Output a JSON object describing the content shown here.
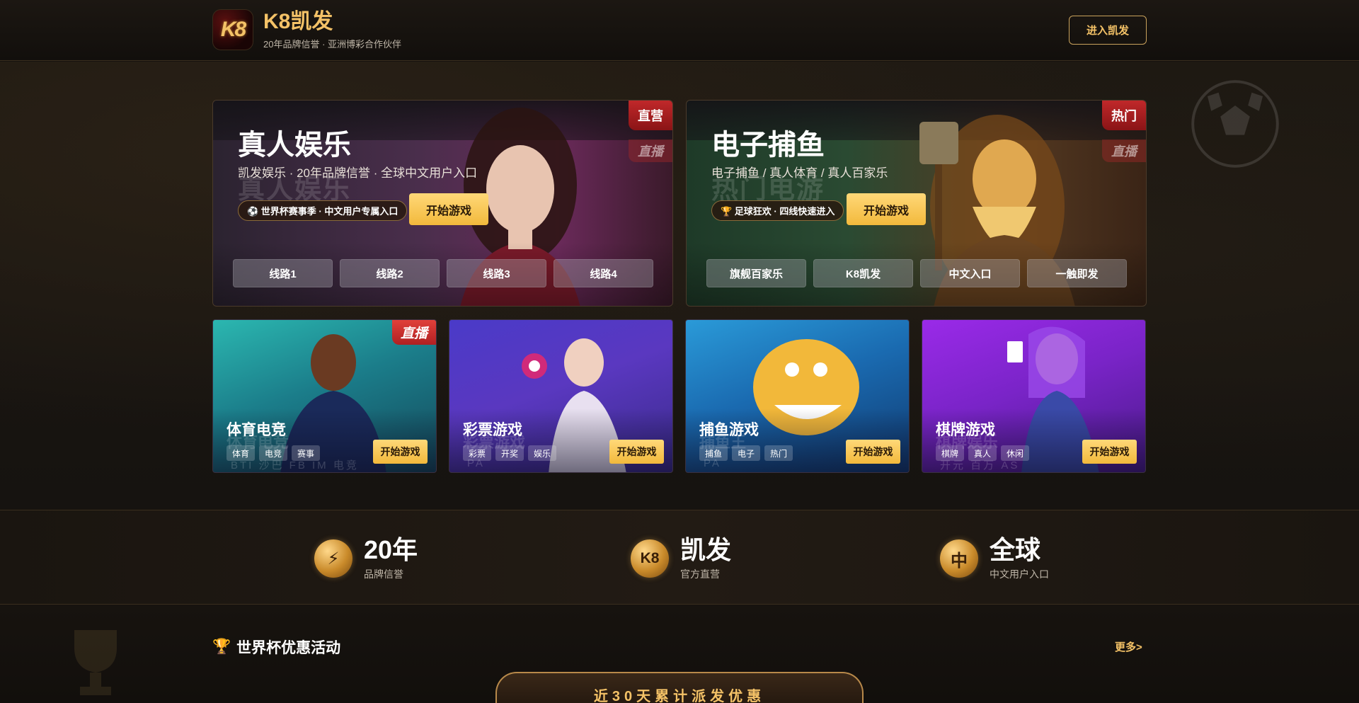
{
  "header": {
    "logo_text": "K8",
    "brand_name": "K8凯发",
    "tagline": "20年品牌信誉 · 亚洲博彩合作伙伴",
    "enter_button": "进入凯发"
  },
  "big_cards": [
    {
      "title": "真人娱乐",
      "ghost_title": "真人娱乐",
      "subtitle": "凯发娱乐 · 20年品牌信誉 · 全球中文用户入口",
      "pill": "⚽ 世界杯赛事季 · 中文用户专属入口",
      "start_button": "开始游戏",
      "corner_badge": "直营",
      "corner_ghost": "直播",
      "lines": [
        "线路1",
        "线路2",
        "线路3",
        "线路4"
      ]
    },
    {
      "title": "电子捕鱼",
      "ghost_title": "热门电游",
      "subtitle": "电子捕鱼 / 真人体育 / 真人百家乐",
      "pill": "🏆 足球狂欢 · 四线快速进入",
      "start_button": "开始游戏",
      "corner_badge": "热门",
      "corner_ghost": "直播",
      "lines": [
        "旗舰百家乐",
        "K8凯发",
        "中文入口",
        "一触即发"
      ]
    }
  ],
  "small_cards": [
    {
      "title": "体育电竞",
      "ghost": "体育电竞",
      "ghost2": "BTI  沙巴  FB  IM  电竞",
      "tags": [
        "体育",
        "电竞",
        "赛事"
      ],
      "start_button": "开始游戏",
      "badge": "直播"
    },
    {
      "title": "彩票游戏",
      "ghost": "彩票游戏",
      "ghost2": "PA",
      "tags": [
        "彩票",
        "开奖",
        "娱乐"
      ],
      "start_button": "开始游戏",
      "badge": ""
    },
    {
      "title": "捕鱼游戏",
      "ghost": "捕鱼王",
      "ghost2": "PA",
      "tags": [
        "捕鱼",
        "电子",
        "热门"
      ],
      "start_button": "开始游戏",
      "badge": ""
    },
    {
      "title": "棋牌游戏",
      "ghost": "棋牌娱乐",
      "ghost2": "开元  百万  AS",
      "tags": [
        "棋牌",
        "真人",
        "休闲"
      ],
      "start_button": "开始游戏",
      "badge": ""
    }
  ],
  "stats": [
    {
      "icon": "⚡",
      "icon_name": "lightning-icon",
      "big": "20年",
      "small": "品牌信誉"
    },
    {
      "icon": "K8",
      "icon_name": "k8-icon",
      "big": "凯发",
      "small": "官方直营"
    },
    {
      "icon": "中",
      "icon_name": "chinese-char-icon",
      "big": "全球",
      "small": "中文用户入口"
    }
  ],
  "promo": {
    "title": "世界杯优惠活动",
    "more": "更多>",
    "banner": "近30天累计派发优惠"
  },
  "colors": {
    "gold": "#f4c267",
    "button_gold": "#f2b93c",
    "badge_red": "#c0282a",
    "background": "#16120e"
  }
}
